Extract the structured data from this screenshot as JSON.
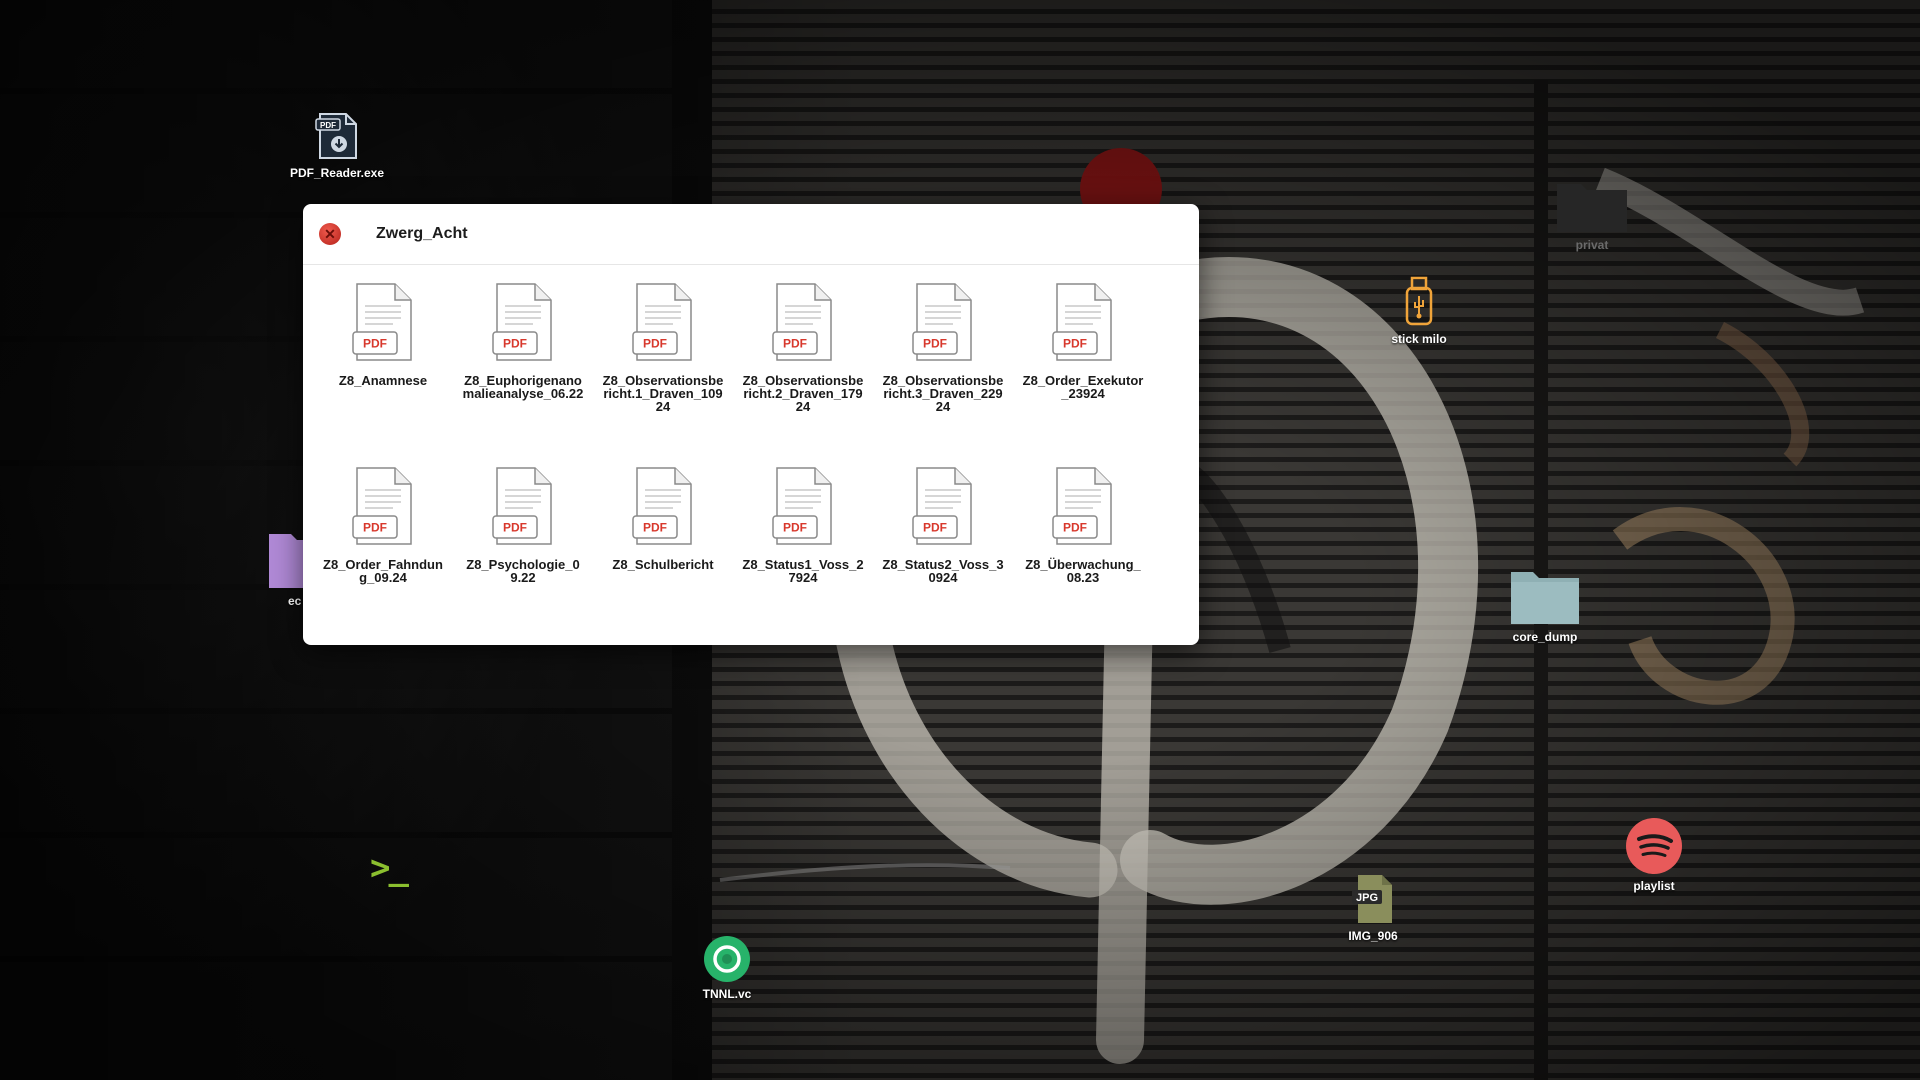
{
  "desktop": {
    "icons": {
      "pdf_reader": {
        "label": "PDF_Reader.exe",
        "badge": "PDF"
      },
      "privat": {
        "label": "privat"
      },
      "stick_milo": {
        "label": "stick milo"
      },
      "core_dump": {
        "label": "core_dump"
      },
      "partial_folder": {
        "label": "ec"
      },
      "playlist": {
        "label": "playlist"
      },
      "img_906": {
        "label": "IMG_906",
        "badge": "JPG"
      },
      "tnnl": {
        "label": "TNNL.vc"
      },
      "terminal": {
        "glyph": ">_"
      }
    }
  },
  "window": {
    "title": "Zwerg_Acht",
    "file_badge": "PDF",
    "files": [
      {
        "name": "Z8_Anamnese"
      },
      {
        "name": "Z8_Euphorigenanomalieanalyse_06.22"
      },
      {
        "name": "Z8_Observationsbericht.1_Draven_10924"
      },
      {
        "name": "Z8_Observationsbericht.2_Draven_17924"
      },
      {
        "name": "Z8_Observationsbericht.3_Draven_22924"
      },
      {
        "name": "Z8_Order_Exekutor_23924"
      },
      {
        "name": "Z8_Order_Fahndung_09.24"
      },
      {
        "name": "Z8_Psychologie_09.22"
      },
      {
        "name": "Z8_Schulbericht"
      },
      {
        "name": "Z8_Status1_Voss_27924"
      },
      {
        "name": "Z8_Status2_Voss_30924"
      },
      {
        "name": "Z8_Überwachung_08.23"
      }
    ]
  },
  "colors": {
    "pdf_red": "#d8382c",
    "spotify_red": "#e85a5a",
    "tnnl_green": "#27b36a",
    "usb_orange": "#f0a43a",
    "folder_teal": "#8fb0b4",
    "folder_purple": "#b089d6",
    "terminal_green": "#8bbf2f"
  }
}
